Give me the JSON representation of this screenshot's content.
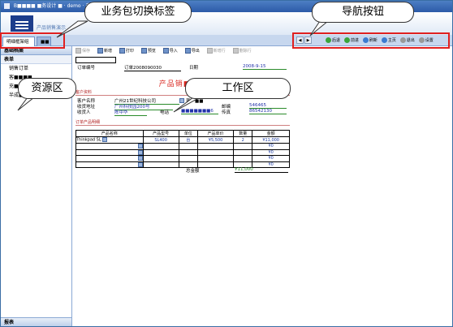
{
  "window": {
    "title": "B■■■■ ■务设计 ■ · demo · 产品销售"
  },
  "banner": {
    "logo_text": "产品销售演示"
  },
  "tabs": [
    {
      "label": "明细框架组"
    },
    {
      "label": "■■"
    }
  ],
  "nav": {
    "back_arrow": "◀",
    "forward_arrow": "▶",
    "buttons": [
      {
        "label": "后退",
        "icon": "green-dot-icon"
      },
      {
        "label": "前进",
        "icon": "green-dot-icon"
      },
      {
        "label": "刷新",
        "icon": "blue-dot-icon"
      },
      {
        "label": "主页",
        "icon": "blue-dot-icon"
      },
      {
        "label": "退出",
        "icon": "gray-dot-icon"
      },
      {
        "label": "设置",
        "icon": "gray-dot-icon"
      }
    ]
  },
  "sidebar": {
    "header": "基础档案",
    "group": "表单",
    "items": [
      "销售订单",
      "客■■■■",
      "充■■■",
      "半成■■■单"
    ],
    "footer": "报表"
  },
  "toolbar": [
    {
      "label": "保存",
      "disabled": true
    },
    {
      "label": "新增",
      "disabled": false
    },
    {
      "label": "打印",
      "disabled": false
    },
    {
      "label": "预览",
      "disabled": false
    },
    {
      "label": "导入",
      "disabled": false
    },
    {
      "label": "导出",
      "disabled": false
    },
    {
      "label": "新增行",
      "disabled": true
    },
    {
      "label": "删除行",
      "disabled": true
    }
  ],
  "form": {
    "order_no_label": "订单编号",
    "order_no_value": "订单2008090030",
    "date_label": "日期",
    "date_value": "2008-9-15",
    "title": "产品销■■■",
    "customer_section": "客户资料",
    "customer_name_label": "客户名称",
    "customer_name_value": "广州21世纪科技公司",
    "customer_extra_label": "客户■■",
    "address_label": "收货地址",
    "address_value": "广州科技园200号",
    "zip_label": "邮编",
    "zip_value": "546465",
    "receiver_label": "收货人",
    "receiver_value": "陈中华",
    "phone_label": "电话",
    "phone_value": "■■■■■■■6",
    "fax_label": "传真",
    "fax_value": "86542130",
    "detail_section": "订单产品明细",
    "columns": [
      "产品名称",
      "产品型号",
      "单位",
      "产品单价",
      "数量",
      "金额"
    ],
    "rows": [
      [
        "Thinkpad SL",
        "SL400",
        "台",
        "¥5,500",
        "2",
        "¥11,000"
      ],
      [
        "",
        "",
        "",
        "",
        "",
        "¥0"
      ],
      [
        "",
        "",
        "",
        "",
        "",
        "¥0"
      ],
      [
        "",
        "",
        "",
        "",
        "",
        "¥0"
      ],
      [
        "",
        "",
        "",
        "",
        "",
        "¥0"
      ]
    ],
    "total_label": "总金额",
    "total_value": "¥11,000"
  },
  "callouts": {
    "tab_switch": "业务包切换标签",
    "nav_buttons": "导航按钮",
    "resource_area": "资源区",
    "work_area": "工作区"
  },
  "colors": {
    "title_red": "#d9271f",
    "callout_border": "#333333",
    "highlight_red": "#e02020",
    "value_blue": "#2233aa",
    "underline_green": "#2b8b2b"
  }
}
